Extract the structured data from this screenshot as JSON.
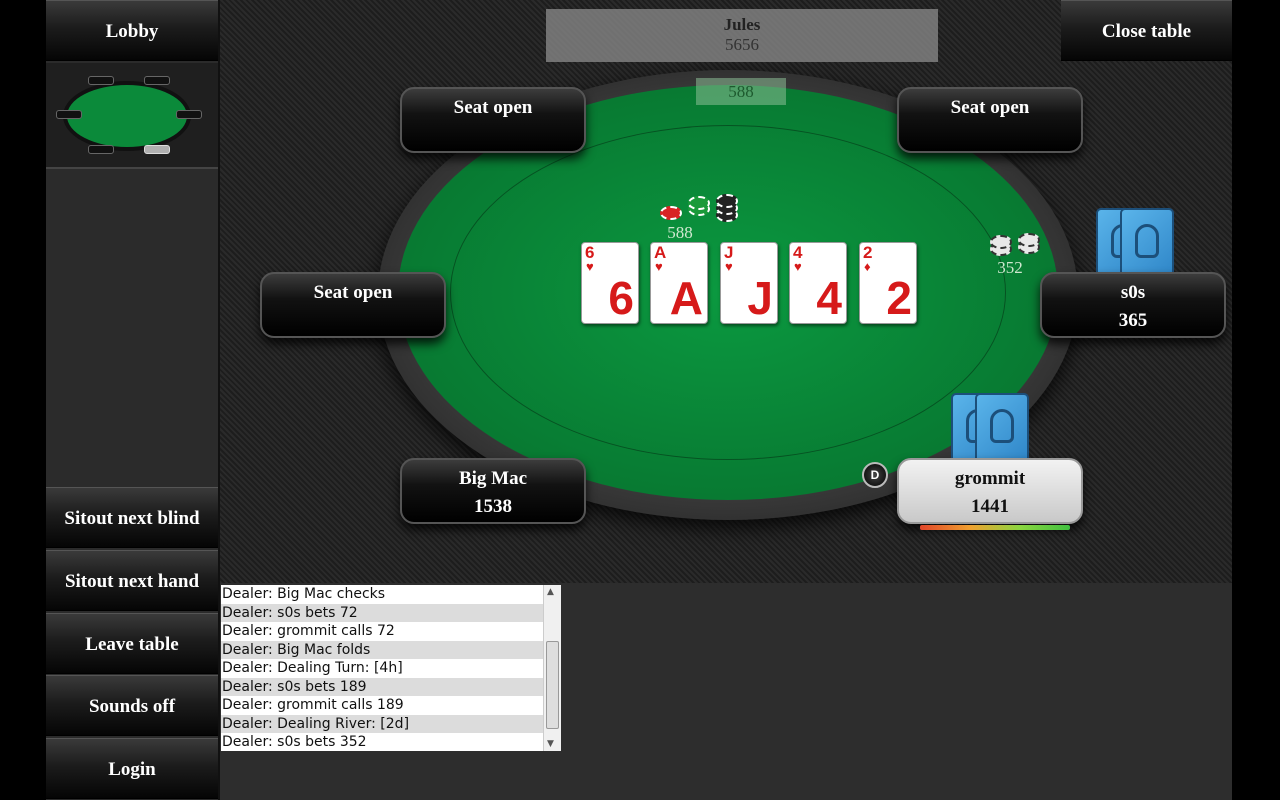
{
  "sidebar": {
    "lobby": "Lobby",
    "buttons": [
      "Sitout next blind",
      "Sitout next hand",
      "Leave table",
      "Sounds off",
      "Login"
    ]
  },
  "header": {
    "close_table": "Close table"
  },
  "top_player": {
    "name": "Jules",
    "stack": "5656"
  },
  "pot": "588",
  "seats": {
    "top_left": {
      "line1": "Seat open"
    },
    "top_right": {
      "line1": "Seat open"
    },
    "left": {
      "line1": "Seat open"
    },
    "right": {
      "name": "s0s",
      "stack": "365"
    },
    "bottom_left": {
      "name": "Big Mac",
      "stack": "1538"
    },
    "bottom_right": {
      "name": "grommit",
      "stack": "1441"
    }
  },
  "dealer_button": "D",
  "board": [
    {
      "rank": "6",
      "suit": "♥"
    },
    {
      "rank": "A",
      "suit": "♥"
    },
    {
      "rank": "J",
      "suit": "♥"
    },
    {
      "rank": "4",
      "suit": "♥"
    },
    {
      "rank": "2",
      "suit": "♦"
    }
  ],
  "bets": {
    "center": "588",
    "right": "352"
  },
  "colors": {
    "felt": "#0b9940",
    "card_red": "#d61a1a",
    "card_back": "#3a9ad8"
  },
  "log": [
    "Dealer: Big Mac checks",
    "Dealer: s0s bets 72",
    "Dealer: grommit calls 72",
    "Dealer: Big Mac folds",
    "Dealer: Dealing Turn: [4h]",
    "Dealer: s0s bets 189",
    "Dealer: grommit calls 189",
    "Dealer: Dealing River: [2d]",
    "Dealer: s0s bets 352"
  ]
}
